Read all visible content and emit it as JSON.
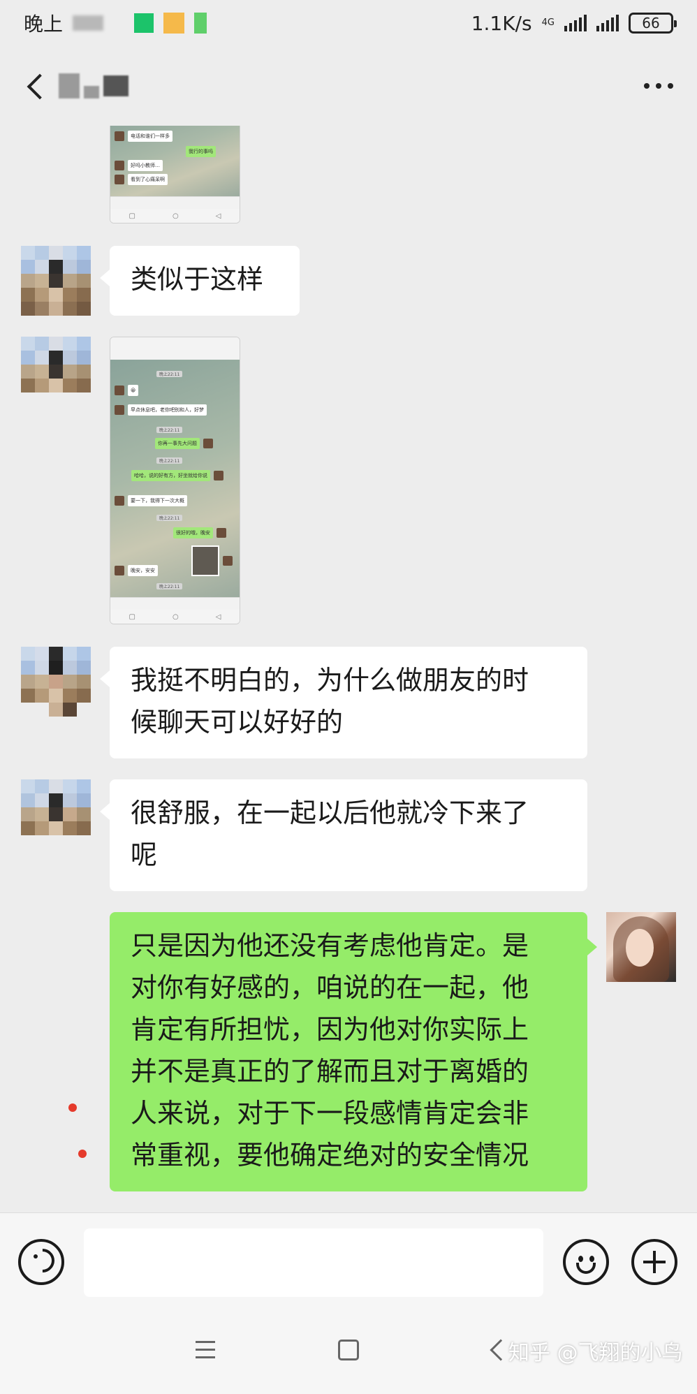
{
  "status_bar": {
    "time_label": "晚上",
    "net_speed": "1.1K/s",
    "network_type": "4G",
    "battery": "66"
  },
  "header": {
    "back_icon": "back-arrow-icon",
    "more_icon": "more-dots-icon"
  },
  "messages": [
    {
      "type": "image",
      "side": "left",
      "description_icon": "chat-screenshot-thumbnail"
    },
    {
      "type": "text",
      "side": "left",
      "text": "类似于这样"
    },
    {
      "type": "image",
      "side": "left",
      "description_icon": "chat-screenshot-thumbnail"
    },
    {
      "type": "text",
      "side": "left",
      "lines": [
        "我挺不明白的，为什么做朋友的时",
        "候聊天可以好好的"
      ]
    },
    {
      "type": "text",
      "side": "left",
      "lines": [
        "很舒服，在一起以后他就冷下来了",
        "呢"
      ]
    },
    {
      "type": "text",
      "side": "right",
      "lines": [
        "只是因为他还没有考虑他肯定。是",
        "对你有好感的，咱说的在一起，他",
        "肯定有所担忧，因为他对你实际上",
        "并不是真正的了解而且对于离婚的",
        "人来说，对于下一段感情肯定会非",
        "常重视，要他确定绝对的安全情况"
      ]
    }
  ],
  "shot_top": {
    "lines": [
      "电话和谁们一样多",
      "我行的事吗",
      "好吗小教师…",
      "看到了心痛呆啊"
    ]
  },
  "shot_mid": {
    "stamps": [
      "晚上22:11",
      "晚上22:11",
      "晚上22:11",
      "晚上22:11",
      "晚上22:11"
    ],
    "lines": [
      "早点休息吧，老你吧别和人，好梦",
      "你再一事先大问题",
      "哈哈，说的好有方，好坐就给你说",
      "要一下，我得下一次大概",
      "很好的哦，晚安",
      "晚安，安安"
    ]
  },
  "input_bar": {
    "voice_icon": "voice-icon",
    "emoji_icon": "emoji-icon",
    "plus_icon": "plus-icon",
    "value": ""
  },
  "system_nav": {
    "menu_icon": "menu-icon",
    "home_icon": "home-icon",
    "back_icon": "back-icon"
  },
  "watermark": "知乎 @飞翔的小鸟",
  "colors": {
    "background": "#ededed",
    "received_bubble": "#ffffff",
    "sent_bubble": "#95ec69",
    "unread_dot": "#e53a2b"
  }
}
